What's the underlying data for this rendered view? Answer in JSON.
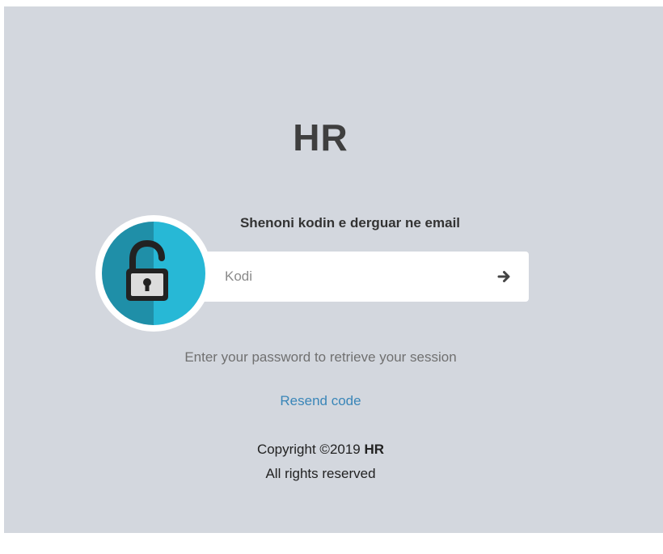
{
  "brand": {
    "title": "HR"
  },
  "form": {
    "instruction": "Shenoni kodin e derguar ne email",
    "code_input": {
      "placeholder": "Kodi",
      "value": ""
    },
    "submit_icon": "arrow-right-icon",
    "avatar_icon": "unlocked-padlock-icon"
  },
  "hint": "Enter your password to retrieve your session",
  "resend_label": "Resend code",
  "footer": {
    "copyright_prefix": "Copyright ©2019",
    "copyright_brand": "HR",
    "rights": "All rights reserved"
  },
  "colors": {
    "background": "#d3d7de",
    "avatar_dark": "#1f8fa8",
    "avatar_light": "#27b8d6",
    "link": "#3a86b8"
  }
}
